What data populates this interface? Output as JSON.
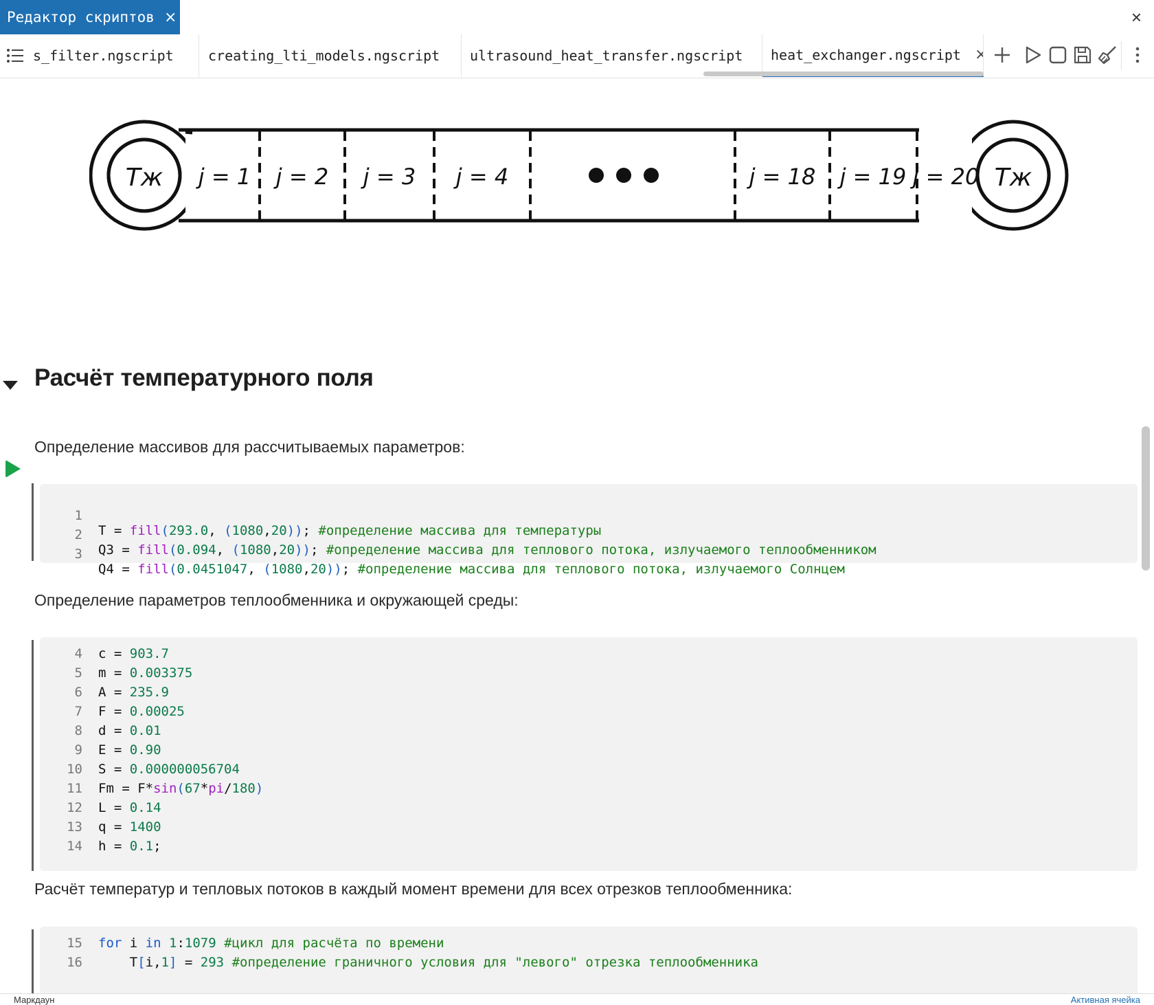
{
  "window": {
    "tab_title": "Редактор скриптов",
    "tab_close": "×",
    "close": "×"
  },
  "file_tabs": [
    {
      "label": "s_filter.ngscript"
    },
    {
      "label": "creating_lti_models.ngscript"
    },
    {
      "label": "ultrasound_heat_transfer.ngscript"
    },
    {
      "label": "heat_exchanger.ngscript",
      "active": true,
      "close": "×"
    }
  ],
  "toolbar": {
    "icons": [
      "plus-icon",
      "play-icon",
      "stop-icon",
      "save-icon",
      "brush-icon",
      "more-vertical-icon"
    ]
  },
  "diagram": {
    "left_label": "Тж",
    "right_label": "Тж",
    "segments": [
      "j = 1",
      "j = 2",
      "j = 3",
      "j = 4",
      "j = 18",
      "j = 19",
      "j = 20"
    ]
  },
  "section": {
    "title": "Расчёт температурного поля"
  },
  "markdown": [
    "Определение массивов для рассчитываемых параметров:",
    "Определение параметров теплообменника и окружающей среды:",
    "Расчёт температур и тепловых потоков в каждый момент времени для всех отрезков теплообменника:"
  ],
  "cells": [
    {
      "lines": [
        {
          "n": "1",
          "t": "T = fill(293.0, (1080,20)); #определение массива для температуры"
        },
        {
          "n": "2",
          "t": "Q3 = fill(0.094, (1080,20)); #определение массива для теплового потока, излучаемого теплообменником"
        },
        {
          "n": "3",
          "t": "Q4 = fill(0.0451047, (1080,20)); #определение массива для теплового потока, излучаемого Солнцем"
        }
      ]
    },
    {
      "lines": [
        {
          "n": "4",
          "t": "c = 903.7"
        },
        {
          "n": "5",
          "t": "m = 0.003375"
        },
        {
          "n": "6",
          "t": "A = 235.9"
        },
        {
          "n": "7",
          "t": "F = 0.00025"
        },
        {
          "n": "8",
          "t": "d = 0.01"
        },
        {
          "n": "9",
          "t": "E = 0.90"
        },
        {
          "n": "10",
          "t": "S = 0.000000056704"
        },
        {
          "n": "11",
          "t": "Fm = F*sin(67*pi/180)"
        },
        {
          "n": "12",
          "t": "L = 0.14"
        },
        {
          "n": "13",
          "t": "q = 1400"
        },
        {
          "n": "14",
          "t": "h = 0.1;"
        }
      ]
    },
    {
      "lines": [
        {
          "n": "15",
          "t": "for i in 1:1079 #цикл для расчёта по времени"
        },
        {
          "n": "16",
          "t": "    T[i,1] = 293 #определение граничного условия для \"левого\" отрезка теплообменника"
        }
      ]
    }
  ],
  "status": {
    "left": "Маркдаун",
    "right": "Активная ячейка"
  }
}
